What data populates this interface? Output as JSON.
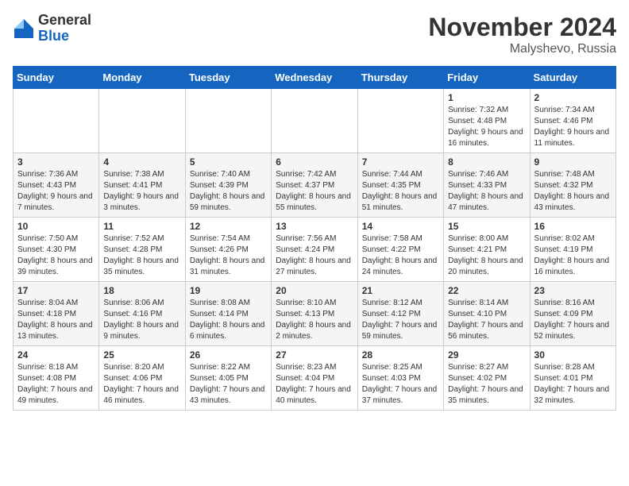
{
  "header": {
    "logo_general": "General",
    "logo_blue": "Blue",
    "month_title": "November 2024",
    "location": "Malyshevo, Russia"
  },
  "weekdays": [
    "Sunday",
    "Monday",
    "Tuesday",
    "Wednesday",
    "Thursday",
    "Friday",
    "Saturday"
  ],
  "weeks": [
    [
      {
        "day": "",
        "detail": ""
      },
      {
        "day": "",
        "detail": ""
      },
      {
        "day": "",
        "detail": ""
      },
      {
        "day": "",
        "detail": ""
      },
      {
        "day": "",
        "detail": ""
      },
      {
        "day": "1",
        "detail": "Sunrise: 7:32 AM\nSunset: 4:48 PM\nDaylight: 9 hours and 16 minutes."
      },
      {
        "day": "2",
        "detail": "Sunrise: 7:34 AM\nSunset: 4:46 PM\nDaylight: 9 hours and 11 minutes."
      }
    ],
    [
      {
        "day": "3",
        "detail": "Sunrise: 7:36 AM\nSunset: 4:43 PM\nDaylight: 9 hours and 7 minutes."
      },
      {
        "day": "4",
        "detail": "Sunrise: 7:38 AM\nSunset: 4:41 PM\nDaylight: 9 hours and 3 minutes."
      },
      {
        "day": "5",
        "detail": "Sunrise: 7:40 AM\nSunset: 4:39 PM\nDaylight: 8 hours and 59 minutes."
      },
      {
        "day": "6",
        "detail": "Sunrise: 7:42 AM\nSunset: 4:37 PM\nDaylight: 8 hours and 55 minutes."
      },
      {
        "day": "7",
        "detail": "Sunrise: 7:44 AM\nSunset: 4:35 PM\nDaylight: 8 hours and 51 minutes."
      },
      {
        "day": "8",
        "detail": "Sunrise: 7:46 AM\nSunset: 4:33 PM\nDaylight: 8 hours and 47 minutes."
      },
      {
        "day": "9",
        "detail": "Sunrise: 7:48 AM\nSunset: 4:32 PM\nDaylight: 8 hours and 43 minutes."
      }
    ],
    [
      {
        "day": "10",
        "detail": "Sunrise: 7:50 AM\nSunset: 4:30 PM\nDaylight: 8 hours and 39 minutes."
      },
      {
        "day": "11",
        "detail": "Sunrise: 7:52 AM\nSunset: 4:28 PM\nDaylight: 8 hours and 35 minutes."
      },
      {
        "day": "12",
        "detail": "Sunrise: 7:54 AM\nSunset: 4:26 PM\nDaylight: 8 hours and 31 minutes."
      },
      {
        "day": "13",
        "detail": "Sunrise: 7:56 AM\nSunset: 4:24 PM\nDaylight: 8 hours and 27 minutes."
      },
      {
        "day": "14",
        "detail": "Sunrise: 7:58 AM\nSunset: 4:22 PM\nDaylight: 8 hours and 24 minutes."
      },
      {
        "day": "15",
        "detail": "Sunrise: 8:00 AM\nSunset: 4:21 PM\nDaylight: 8 hours and 20 minutes."
      },
      {
        "day": "16",
        "detail": "Sunrise: 8:02 AM\nSunset: 4:19 PM\nDaylight: 8 hours and 16 minutes."
      }
    ],
    [
      {
        "day": "17",
        "detail": "Sunrise: 8:04 AM\nSunset: 4:18 PM\nDaylight: 8 hours and 13 minutes."
      },
      {
        "day": "18",
        "detail": "Sunrise: 8:06 AM\nSunset: 4:16 PM\nDaylight: 8 hours and 9 minutes."
      },
      {
        "day": "19",
        "detail": "Sunrise: 8:08 AM\nSunset: 4:14 PM\nDaylight: 8 hours and 6 minutes."
      },
      {
        "day": "20",
        "detail": "Sunrise: 8:10 AM\nSunset: 4:13 PM\nDaylight: 8 hours and 2 minutes."
      },
      {
        "day": "21",
        "detail": "Sunrise: 8:12 AM\nSunset: 4:12 PM\nDaylight: 7 hours and 59 minutes."
      },
      {
        "day": "22",
        "detail": "Sunrise: 8:14 AM\nSunset: 4:10 PM\nDaylight: 7 hours and 56 minutes."
      },
      {
        "day": "23",
        "detail": "Sunrise: 8:16 AM\nSunset: 4:09 PM\nDaylight: 7 hours and 52 minutes."
      }
    ],
    [
      {
        "day": "24",
        "detail": "Sunrise: 8:18 AM\nSunset: 4:08 PM\nDaylight: 7 hours and 49 minutes."
      },
      {
        "day": "25",
        "detail": "Sunrise: 8:20 AM\nSunset: 4:06 PM\nDaylight: 7 hours and 46 minutes."
      },
      {
        "day": "26",
        "detail": "Sunrise: 8:22 AM\nSunset: 4:05 PM\nDaylight: 7 hours and 43 minutes."
      },
      {
        "day": "27",
        "detail": "Sunrise: 8:23 AM\nSunset: 4:04 PM\nDaylight: 7 hours and 40 minutes."
      },
      {
        "day": "28",
        "detail": "Sunrise: 8:25 AM\nSunset: 4:03 PM\nDaylight: 7 hours and 37 minutes."
      },
      {
        "day": "29",
        "detail": "Sunrise: 8:27 AM\nSunset: 4:02 PM\nDaylight: 7 hours and 35 minutes."
      },
      {
        "day": "30",
        "detail": "Sunrise: 8:28 AM\nSunset: 4:01 PM\nDaylight: 7 hours and 32 minutes."
      }
    ]
  ]
}
